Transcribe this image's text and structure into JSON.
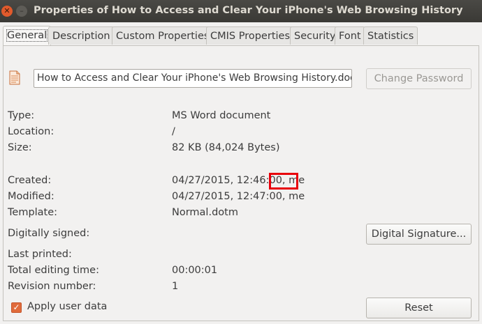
{
  "window": {
    "title": "Properties of How to Access and Clear Your iPhone's Web Browsing History",
    "close_glyph": "✕",
    "minimize_glyph": "–"
  },
  "tabs": [
    "General",
    "Description",
    "Custom Properties",
    "CMIS Properties",
    "Security",
    "Font",
    "Statistics"
  ],
  "general": {
    "filename": "How to Access and Clear Your iPhone's Web Browsing History.docx",
    "change_password_label": "Change Password",
    "type_label": "Type:",
    "type_value": "MS Word document",
    "location_label": "Location:",
    "location_value": "/",
    "size_label": "Size:",
    "size_value": "82 KB (84,024 Bytes)",
    "created_label": "Created:",
    "created_value": "04/27/2015, 12:46:00, me",
    "modified_label": "Modified:",
    "modified_value": "04/27/2015, 12:47:00, me",
    "template_label": "Template:",
    "template_value": "Normal.dotm",
    "signed_label": "Digitally signed:",
    "digital_signature_label": "Digital Signature...",
    "printed_label": "Last printed:",
    "editing_label": "Total editing time:",
    "editing_value": "00:00:01",
    "revision_label": "Revision number:",
    "revision_value": "1",
    "apply_user_data_label": "Apply user data",
    "apply_user_data_checked": true,
    "reset_label": "Reset"
  },
  "colors": {
    "accent": "#e06b3b",
    "highlight": "#e8000b",
    "titlebar": "#3c3b37"
  }
}
